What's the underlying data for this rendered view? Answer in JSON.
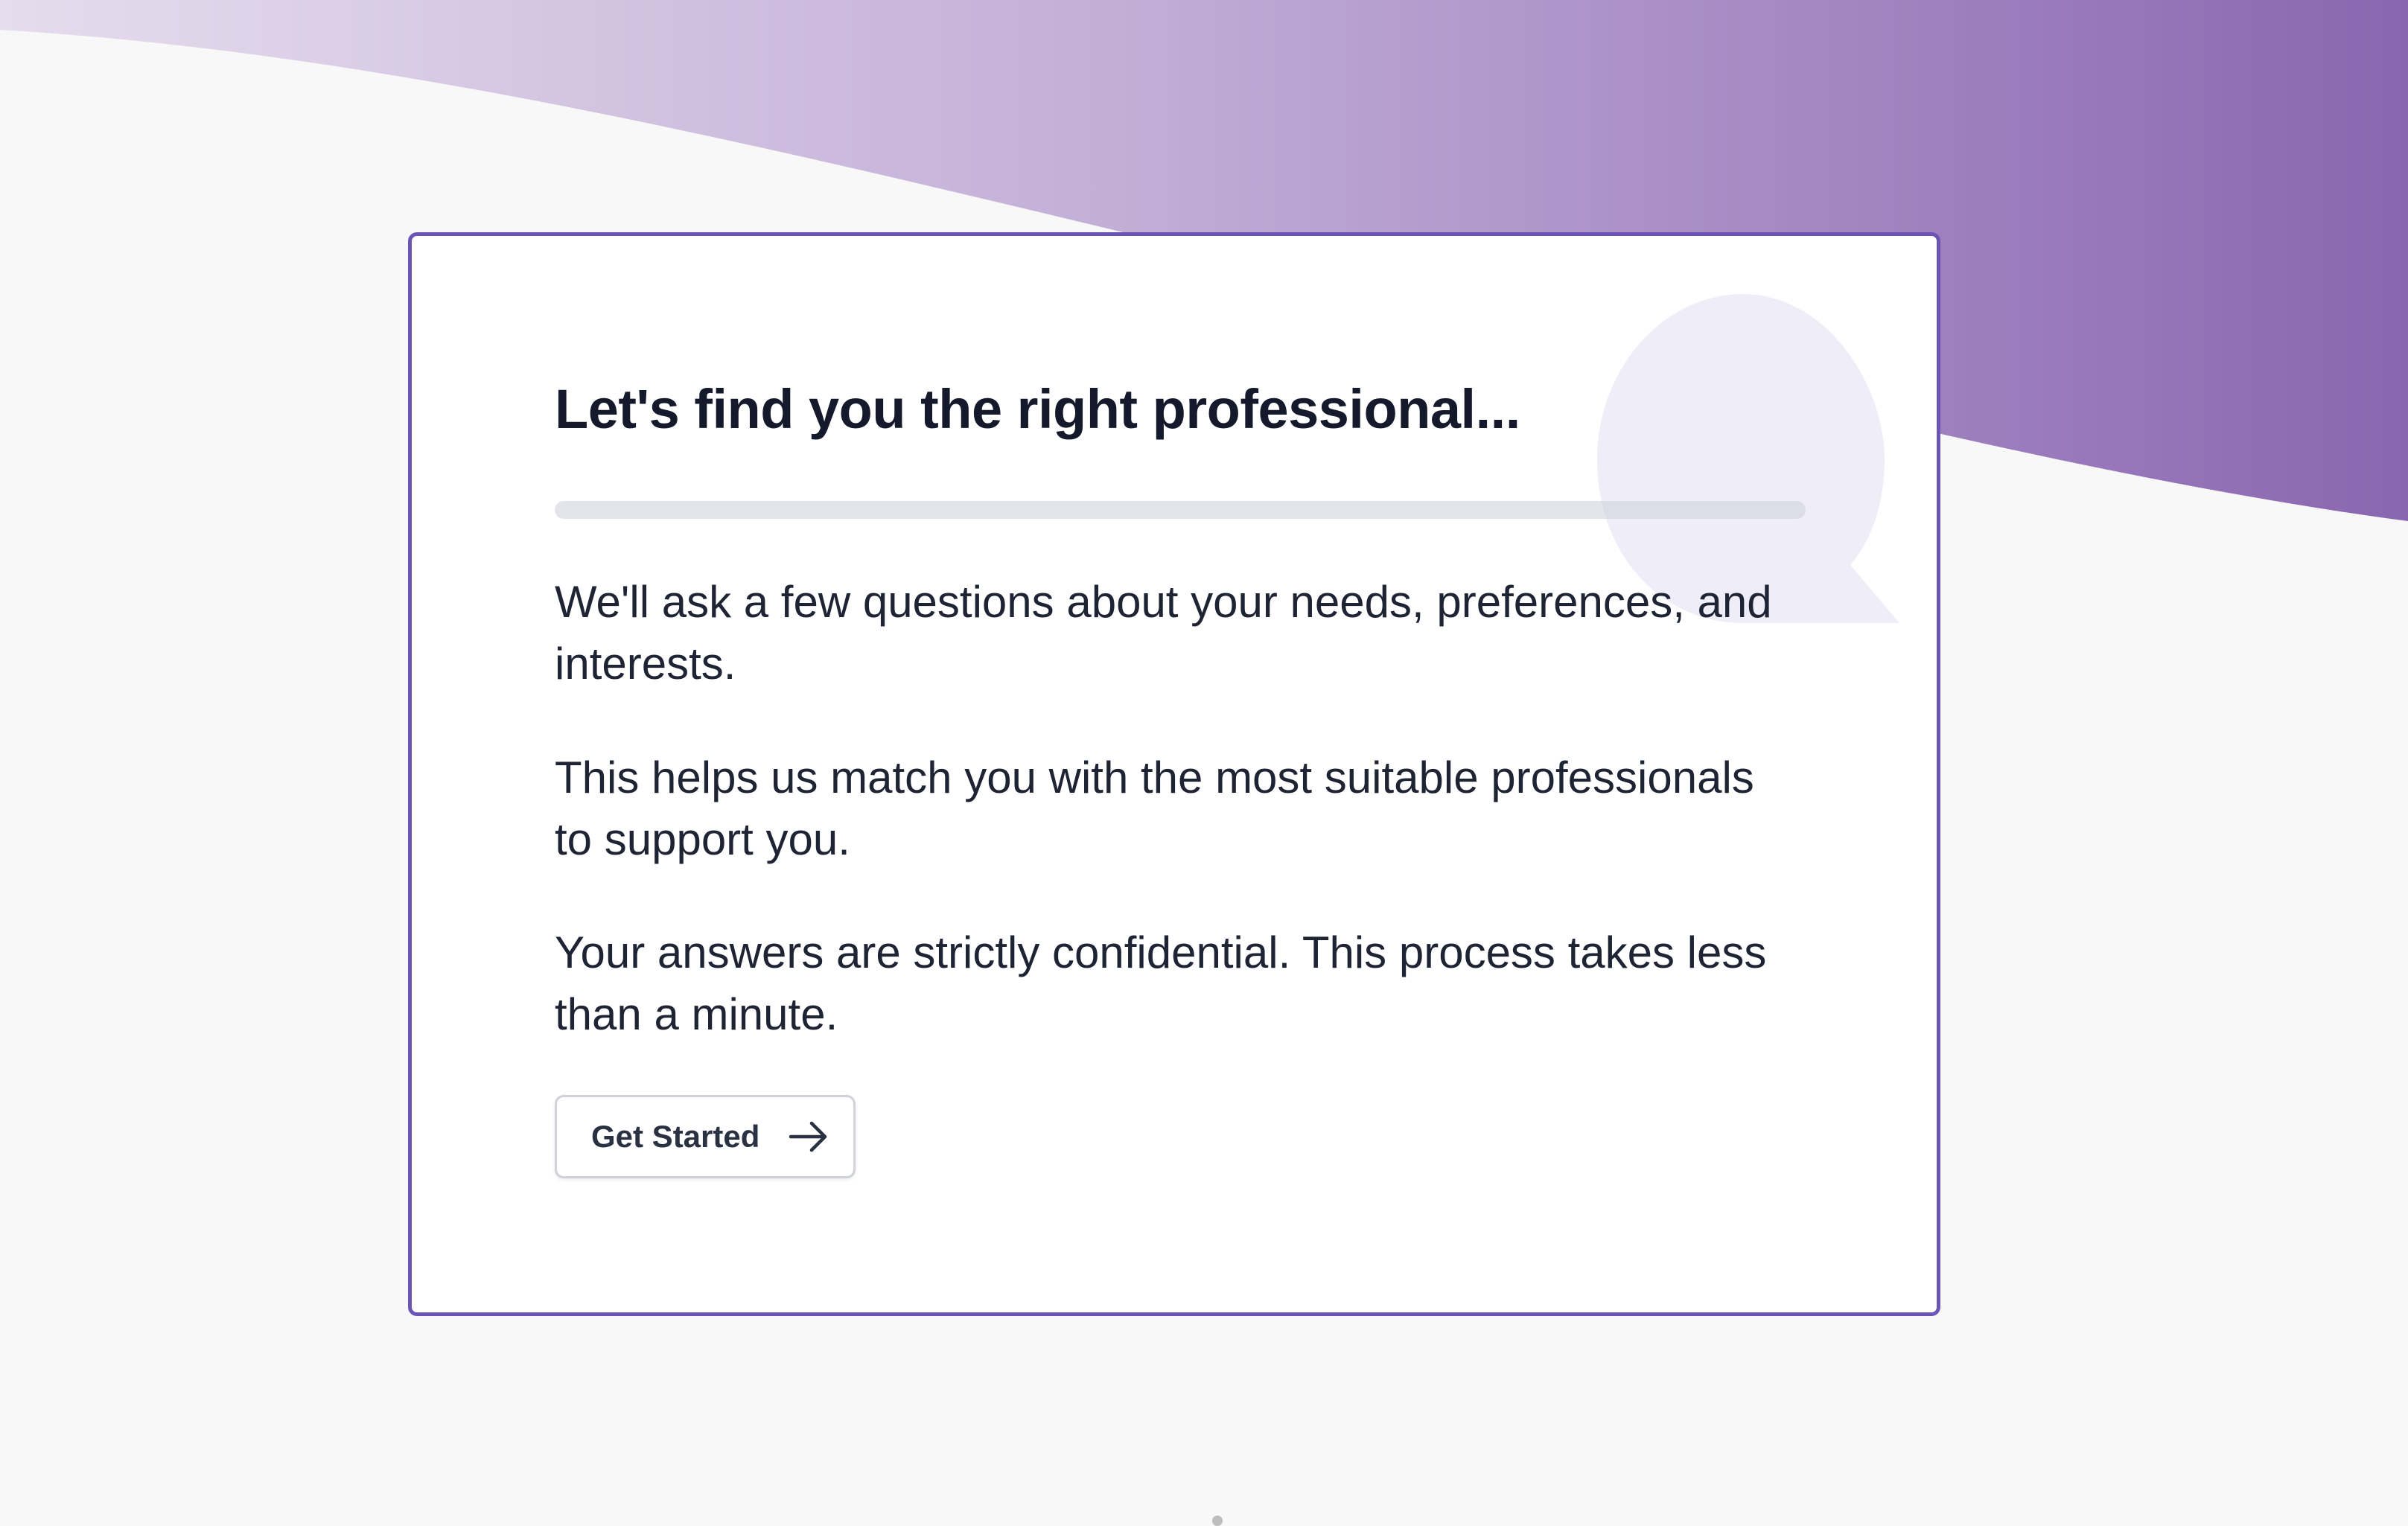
{
  "page": {
    "heading": "Let's find you the right professional...",
    "progress": 0,
    "paragraphs": [
      "We'll ask a few questions about your needs, preferences, and interests.",
      "This helps us match you with the most suitable professionals to support you.",
      "Your answers are strictly confidential. This process takes less than a minute."
    ],
    "cta": {
      "label": "Get Started",
      "icon": "arrow-right-icon"
    },
    "decoration": {
      "background": "wave",
      "watermark_icon": "speech-bubble-icon"
    }
  },
  "colors": {
    "page_background": "#f8f8f8",
    "wave_light": "#e6dced",
    "wave_dark": "#8a66b0",
    "card_border": "#6a55b4",
    "bubble": "#efedf8",
    "heading_text": "#141a2b",
    "body_text": "#1e2434",
    "progress_track": "#e2e4e9"
  }
}
